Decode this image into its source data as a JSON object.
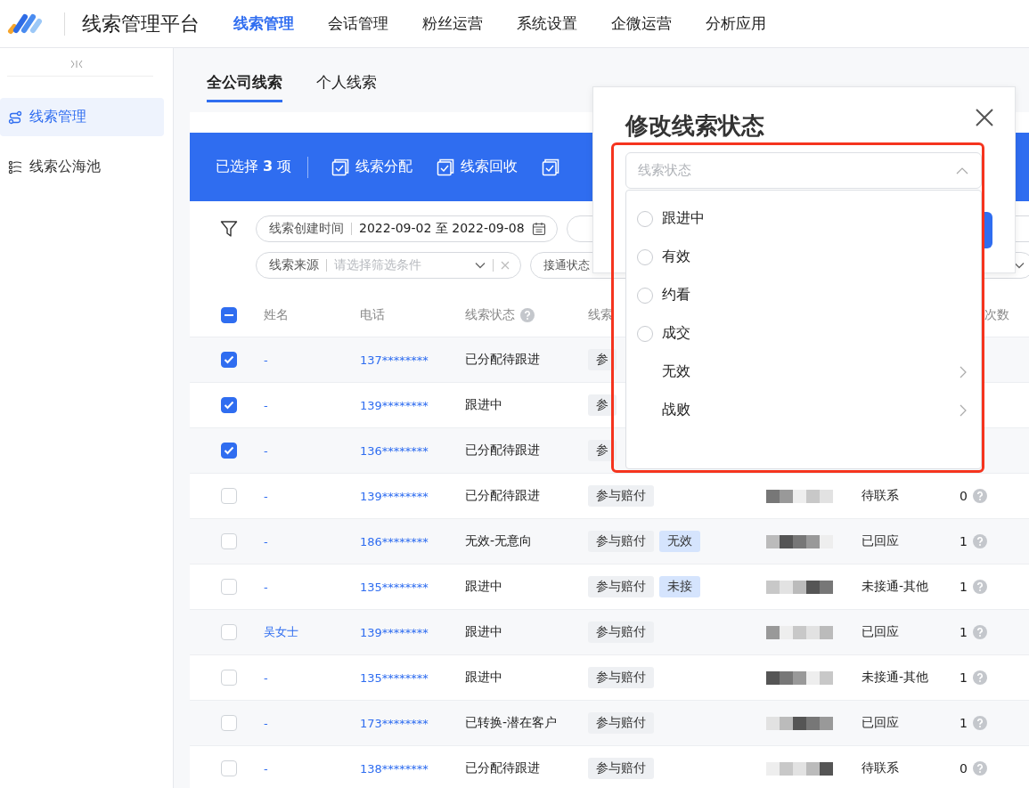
{
  "header": {
    "title": "线索管理平台",
    "nav": [
      {
        "label": "线索管理",
        "selected": true
      },
      {
        "label": "会话管理",
        "selected": false
      },
      {
        "label": "粉丝运营",
        "selected": false
      },
      {
        "label": "系统设置",
        "selected": false
      },
      {
        "label": "企微运营",
        "selected": false
      },
      {
        "label": "分析应用",
        "selected": false
      }
    ]
  },
  "sidebar": {
    "items": [
      {
        "label": "线索管理",
        "kind": "route",
        "selected": true
      },
      {
        "label": "线索公海池",
        "kind": "list",
        "selected": false
      }
    ]
  },
  "tabs": [
    {
      "label": "全公司线索",
      "selected": true
    },
    {
      "label": "个人线索",
      "selected": false
    }
  ],
  "selection_bar": {
    "count_text": "已选择 **3** 项",
    "actions": [
      {
        "label": "线索分配"
      },
      {
        "label": "线索回收"
      }
    ]
  },
  "filters": {
    "row1": [
      {
        "label": "线索创建时间",
        "value": "2022-09-02 至 2022-09-08",
        "kind": "date"
      }
    ],
    "row2": [
      {
        "label": "线索来源",
        "placeholder": "请选择筛选条件",
        "kind": "select"
      },
      {
        "label": "接通状态",
        "kind": "wide"
      }
    ]
  },
  "table": {
    "select_all_partial": true,
    "columns": {
      "name": "姓名",
      "phone": "电话",
      "status": "线索状态",
      "tags": "线索",
      "count": "次数"
    },
    "rows": [
      {
        "checked": true,
        "name": "-",
        "phone": "137********",
        "status": "已分配待跟进",
        "tags": [
          {
            "text": "参",
            "kind": "plain"
          }
        ]
      },
      {
        "checked": true,
        "name": "-",
        "phone": "139********",
        "status": "跟进中",
        "tags": [
          {
            "text": "参",
            "kind": "plain"
          }
        ]
      },
      {
        "checked": true,
        "name": "-",
        "phone": "136********",
        "status": "已分配待跟进",
        "tags": [
          {
            "text": "参",
            "kind": "plain"
          }
        ]
      },
      {
        "checked": false,
        "name": "-",
        "phone": "139********",
        "status": "已分配待跟进",
        "tags": [
          {
            "text": "参与赔付",
            "kind": "plain"
          }
        ],
        "contact": "待联系",
        "count": "0"
      },
      {
        "checked": false,
        "name": "-",
        "phone": "186********",
        "status": "无效-无意向",
        "tags": [
          {
            "text": "参与赔付",
            "kind": "plain"
          },
          {
            "text": "无效",
            "kind": "accent"
          }
        ],
        "contact": "已回应",
        "count": "1"
      },
      {
        "checked": false,
        "name": "-",
        "phone": "135********",
        "status": "跟进中",
        "tags": [
          {
            "text": "参与赔付",
            "kind": "plain"
          },
          {
            "text": "未接",
            "kind": "accent"
          }
        ],
        "contact": "未接通-其他",
        "count": "1"
      },
      {
        "checked": false,
        "name": "吴女士",
        "phone": "139********",
        "status": "跟进中",
        "tags": [
          {
            "text": "参与赔付",
            "kind": "plain"
          }
        ],
        "contact": "已回应",
        "count": "1"
      },
      {
        "checked": false,
        "name": "-",
        "phone": "135********",
        "status": "跟进中",
        "tags": [
          {
            "text": "参与赔付",
            "kind": "plain"
          }
        ],
        "contact": "未接通-其他",
        "count": "1"
      },
      {
        "checked": false,
        "name": "-",
        "phone": "173********",
        "status": "已转换-潜在客户",
        "tags": [
          {
            "text": "参与赔付",
            "kind": "plain"
          }
        ],
        "contact": "已回应",
        "count": "1"
      },
      {
        "checked": false,
        "name": "-",
        "phone": "138********",
        "status": "已分配待跟进",
        "tags": [
          {
            "text": "参与赔付",
            "kind": "plain"
          }
        ],
        "contact": "待联系",
        "count": "0"
      }
    ]
  },
  "modal": {
    "title": "修改线索状态",
    "select": {
      "placeholder": "线索状态",
      "expanded": true
    },
    "options": [
      {
        "label": "跟进中",
        "kind": "radio",
        "selected": false
      },
      {
        "label": "有效",
        "kind": "radio",
        "selected": false
      },
      {
        "label": "约看",
        "kind": "radio",
        "selected": false
      },
      {
        "label": "成交",
        "kind": "radio",
        "selected": false
      },
      {
        "label": "无效",
        "kind": "submenu"
      },
      {
        "label": "战败",
        "kind": "submenu"
      }
    ]
  }
}
